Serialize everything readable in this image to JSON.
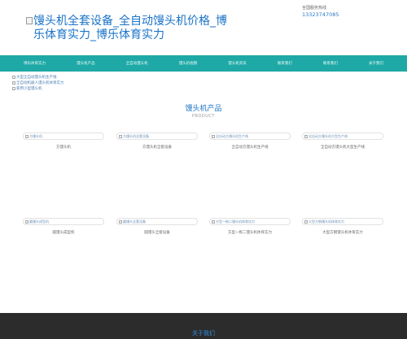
{
  "header": {
    "logo_alt": "馒头机全套设备_全自动馒头机价格_博乐体育实力_博乐体育实力",
    "contact_label": "全国服务热线",
    "contact_phone": "13323747085"
  },
  "nav": {
    "items": [
      "博乐体育实力",
      "馒头机产品",
      "全自动馒头机",
      "馒头机视频",
      "馒头机资讯",
      "联系我们",
      "联系我们",
      "关于我们"
    ]
  },
  "links": [
    "大型全自动馒头机生产线",
    "全自动机器人馒头机体育实力",
    "家用小型馒头机"
  ],
  "section": {
    "title_cn": "馒头机产品",
    "title_en": "PRODUCT"
  },
  "products": [
    {
      "alt": "方馒头机",
      "name": "方馒头机"
    },
    {
      "alt": "方馒头机全套设备",
      "name": "方馒头机全套设备"
    },
    {
      "alt": "全自动方馒头机生产线",
      "name": "全自动方馒头机生产线"
    },
    {
      "alt": "全自动方馒头机大型生产线",
      "name": "全自动方馒头机大型生产线"
    },
    {
      "alt": "圆馒头成型机",
      "name": "圆馒头成型机"
    },
    {
      "alt": "圆馒头全套设备",
      "name": "圆馒头全套设备"
    },
    {
      "alt": "方型一拖二馒头机体育实力",
      "name": "方型一拖二馒头机体育实力"
    },
    {
      "alt": "大型方钢馒头机体育实力",
      "name": "大型方钢馒头机体育实力"
    }
  ],
  "footer": {
    "title": "关于我们"
  }
}
